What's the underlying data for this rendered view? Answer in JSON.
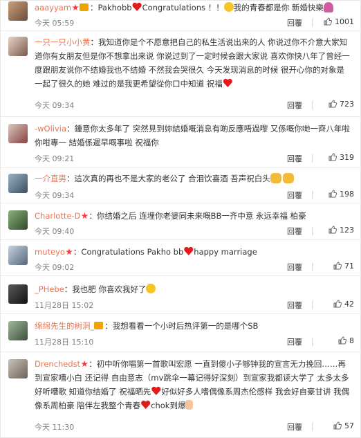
{
  "reply_label": "回覆",
  "comments": [
    {
      "user": "aaayyam",
      "pre": "：Pakhobb",
      "mid": "Congratulations ！！",
      "post": "我的青春都是你 新婚快樂",
      "time": "今天 05:59",
      "likes": "1001"
    },
    {
      "user": "一只一只小小黄",
      "text": "：我知道你是个不愿意把自己的私生活说出来的人 你说过你不介意大家知道你有女朋友但是你不想拿出来说 你说过到了一定时候会跟大家说 喜欢你快八年了曾经一度跟朋友说你不结婚我也不结婚 不然我会哭很久 今天发现消息的时候 很开心你的对象是一起了很久的她 难过的是我更希望從你口中知道 祝福",
      "time": "今天 09:34",
      "likes": "723"
    },
    {
      "user": "-wOlivia",
      "text": "：鍾意你太多年了 突然見到妳結婚嘅消息有啲反應唔過嚟 又係嘅你哋一齊八年啦 你咁專一 結婚係遲早嘅事啦 祝福你",
      "time": "今天 09:21",
      "likes": "319"
    },
    {
      "user": "一介直男",
      "text": "：這次真的再也不是大家的老公了 合泪饮喜酒 吾声祝白头",
      "time": "今天 09:34",
      "likes": "198"
    },
    {
      "user": "Charlotte-D",
      "text": "：你结婚之后 连埋你老婆同未来嘅BB一齐中意 永远幸福 柏豪",
      "time": "今天 09:40",
      "likes": "123"
    },
    {
      "user": "muteyo",
      "pre": "：Congratulations Pakho bb",
      "post": "happy marriage",
      "time": "今天 09:02",
      "likes": "71"
    },
    {
      "user": "_PHebe",
      "text": "：我也肥 你喜欢我好了",
      "time": "11月28日 15:02",
      "likes": "42"
    },
    {
      "user": "绵绵先生的树洞_",
      "text": "：我想看看一个小时后热评第一的是哪个SB",
      "time": "11月28日 15:10",
      "likes": "8"
    },
    {
      "user": "Drenchedst",
      "text1": "：初中听你唱第一首歌叫宏愿 一直到傻小子够钟我的宣言无力挽回……再到宣家嘈小白 还记得 自由意志（mv跳伞一幕记得好深刻）到宣家我都读大学了 太多太多好听嘈歌 知道你结婚了 祝福晒先",
      "text2": "好似好多人嗜偶像系周杰伦感样 我会好自豪甘讲 我偶像系周柏豪 陪伴左我整个青春",
      "text3": "chok到爆",
      "time": "今天 11:30",
      "likes": "57"
    }
  ]
}
